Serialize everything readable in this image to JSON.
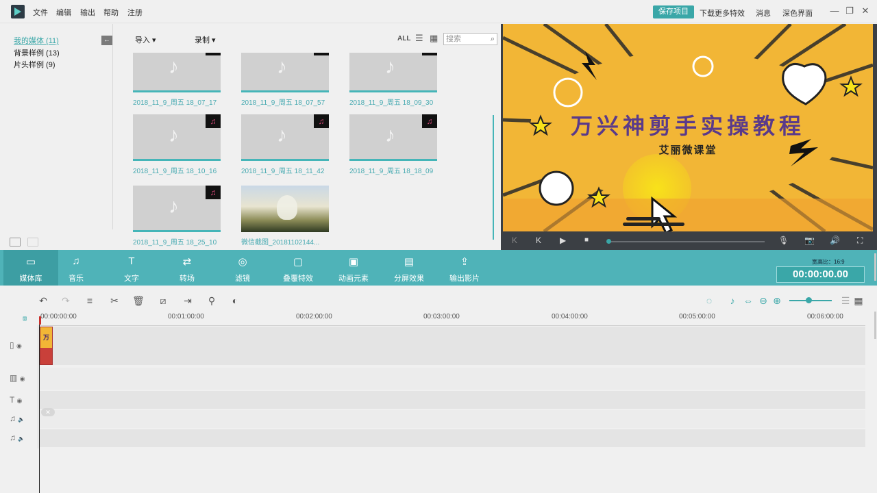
{
  "menu": {
    "file": "文件",
    "edit": "编辑",
    "export": "输出",
    "help": "帮助",
    "register": "注册"
  },
  "topright": {
    "save_project": "保存项目",
    "download_effects": "下载更多特效",
    "messages": "消息",
    "dark_ui": "深色界面"
  },
  "window_controls": {
    "minimize": "—",
    "restore": "❐",
    "close": "✕"
  },
  "left_tree": {
    "items": [
      {
        "label": "我的媒体 (11)"
      },
      {
        "label": "背景样例 (13)"
      },
      {
        "label": "片头样例 (9)"
      }
    ],
    "collapse_icon": "←"
  },
  "media_toolbar": {
    "import": "导入",
    "record": "录制",
    "all": "ALL",
    "search_placeholder": "搜索",
    "search_icon": "⌕"
  },
  "media_items": [
    {
      "label": "2018_11_9_周五 18_07_17"
    },
    {
      "label": "2018_11_9_周五 18_07_57"
    },
    {
      "label": "2018_11_9_周五 18_09_30"
    },
    {
      "label": "2018_11_9_周五 18_10_16"
    },
    {
      "label": "2018_11_9_周五 18_11_42"
    },
    {
      "label": "2018_11_9_周五 18_18_09"
    },
    {
      "label": "2018_11_9_周五 18_25_10"
    },
    {
      "label": "微信截图_20181102144..."
    }
  ],
  "media_glyphs": {
    "note": "♪",
    "badge": "♫"
  },
  "preview": {
    "title": "万兴神剪手实操教程",
    "subtitle": "艾丽微课堂",
    "colors": {
      "bg": "#f2b636",
      "title": "#5a3a8a"
    }
  },
  "preview_controls": {
    "prev": "K",
    "next": "K",
    "play": "▶",
    "stop": "■",
    "mic": "🎙",
    "snapshot": "📷",
    "volume": "🔊",
    "fullscreen": "⛶"
  },
  "modules": [
    {
      "label": "媒体库",
      "icon": "▭"
    },
    {
      "label": "音乐",
      "icon": "♫"
    },
    {
      "label": "文字",
      "icon": "T"
    },
    {
      "label": "转场",
      "icon": "⇄"
    },
    {
      "label": "滤镜",
      "icon": "◎"
    },
    {
      "label": "叠覆特效",
      "icon": "▢"
    },
    {
      "label": "动画元素",
      "icon": "▣"
    },
    {
      "label": "分屏效果",
      "icon": "▤"
    },
    {
      "label": "输出影片",
      "icon": "⇪"
    }
  ],
  "aspect_ratio": "宽高比：16:9",
  "timecode": "00:00:00.00",
  "timeline_tools": {
    "undo": "↶",
    "redo": "↷",
    "adjust": "≡",
    "cut": "✂",
    "delete": "🗑",
    "crop": "⧄",
    "split": "⇥",
    "marker": "⚲",
    "color": "◐",
    "render": "◌",
    "audio_mix": "♪",
    "fit": "⇔",
    "zoom_out": "⊖",
    "zoom_in": "⊕",
    "list_view": "☰",
    "grid_view": "▦"
  },
  "ruler_ticks": [
    "00:00:00:00",
    "00:01:00:00",
    "00:02:00:00",
    "00:03:00:00",
    "00:04:00:00",
    "00:05:00:00",
    "00:06:00:00"
  ],
  "track_icons": {
    "video": "▯",
    "eye": "◉",
    "overlay": "▥",
    "text": "T",
    "music": "♫",
    "speaker": "🔈"
  },
  "clip": {
    "label": "万"
  },
  "marker_chip": "✕"
}
